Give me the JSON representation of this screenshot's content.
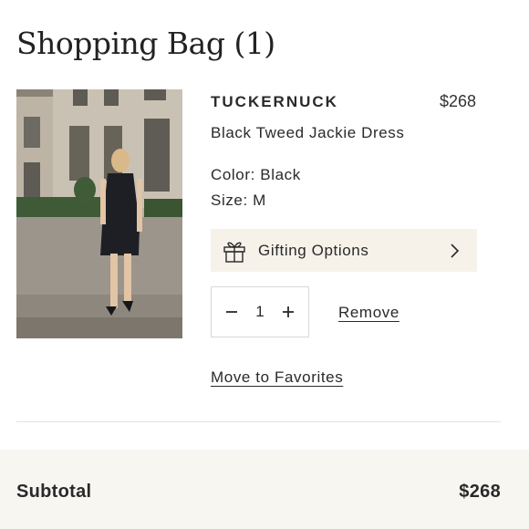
{
  "header": {
    "title": "Shopping Bag (1)"
  },
  "item": {
    "brand": "TUCKERNUCK",
    "price": "$268",
    "name": "Black Tweed Jackie Dress",
    "color_label": "Color: Black",
    "size_label": "Size: M",
    "quantity": "1",
    "image_icon": "product-photo"
  },
  "gifting": {
    "label": "Gifting Options",
    "icon": "gift-icon"
  },
  "actions": {
    "remove_label": "Remove",
    "favorites_label": "Move to Favorites"
  },
  "summary": {
    "subtotal_label": "Subtotal",
    "subtotal_value": "$268"
  },
  "colors": {
    "accent_bg": "#f6f2ea",
    "subtotal_bg": "#f8f6f1",
    "text": "#2a2a2a"
  }
}
